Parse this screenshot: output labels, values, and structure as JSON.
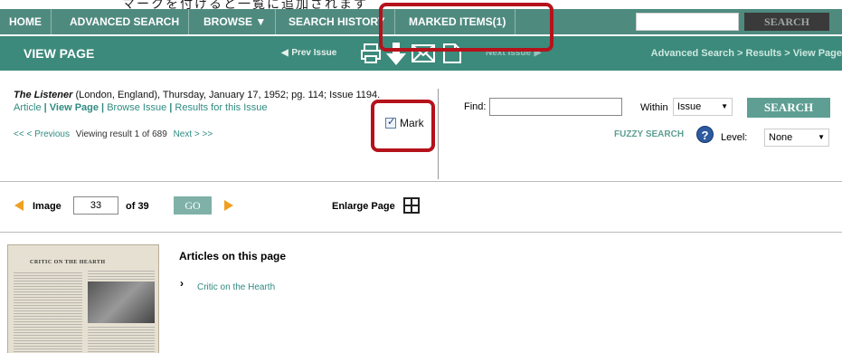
{
  "top_annotation": "マークを付けると一覧に追加されます",
  "nav": {
    "home": "HOME",
    "advanced_search": "ADVANCED SEARCH",
    "browse": "BROWSE ▼",
    "search_history": "SEARCH HISTORY",
    "marked_items": "MARKED ITEMS(1)",
    "search_button": "SEARCH"
  },
  "subbar": {
    "title": "VIEW PAGE",
    "prev_issue": "Prev Issue",
    "next_issue": "Next Issue",
    "breadcrumb": "Advanced Search > Results > View Page"
  },
  "citation": {
    "publication": "The Listener",
    "details": " (London, England),  Thursday, January 17, 1952; pg. 114; Issue 1194."
  },
  "links": {
    "article": "Article",
    "view_page": "View Page",
    "browse_issue": "Browse Issue",
    "results": "Results for this Issue"
  },
  "mark": {
    "label": "Mark",
    "checked": true
  },
  "paging": {
    "first": "<<",
    "previous": "< Previous",
    "result": "Viewing result 1 of 689",
    "next": "Next >",
    "last": ">>"
  },
  "search_panel": {
    "find_label": "Find:",
    "find_value": "",
    "within_label": "Within",
    "within_value": "Issue",
    "search_button": "SEARCH",
    "fuzzy_label": "FUZZY SEARCH",
    "level_label": "Level:",
    "level_value": "None"
  },
  "image_bar": {
    "image_label": "Image",
    "image_value": "33",
    "of_label": "of 39",
    "go_button": "GO",
    "enlarge_label": "Enlarge Page"
  },
  "thumbnail": {
    "headline": "CRITIC ON THE HEARTH"
  },
  "articles": {
    "title": "Articles on this page",
    "items": [
      "Critic on the Hearth"
    ]
  },
  "colors": {
    "nav_bg": "#4f8a7f",
    "subbar_bg": "#3c8a7b",
    "link": "#2f8b82",
    "highlight": "#b5121b"
  }
}
